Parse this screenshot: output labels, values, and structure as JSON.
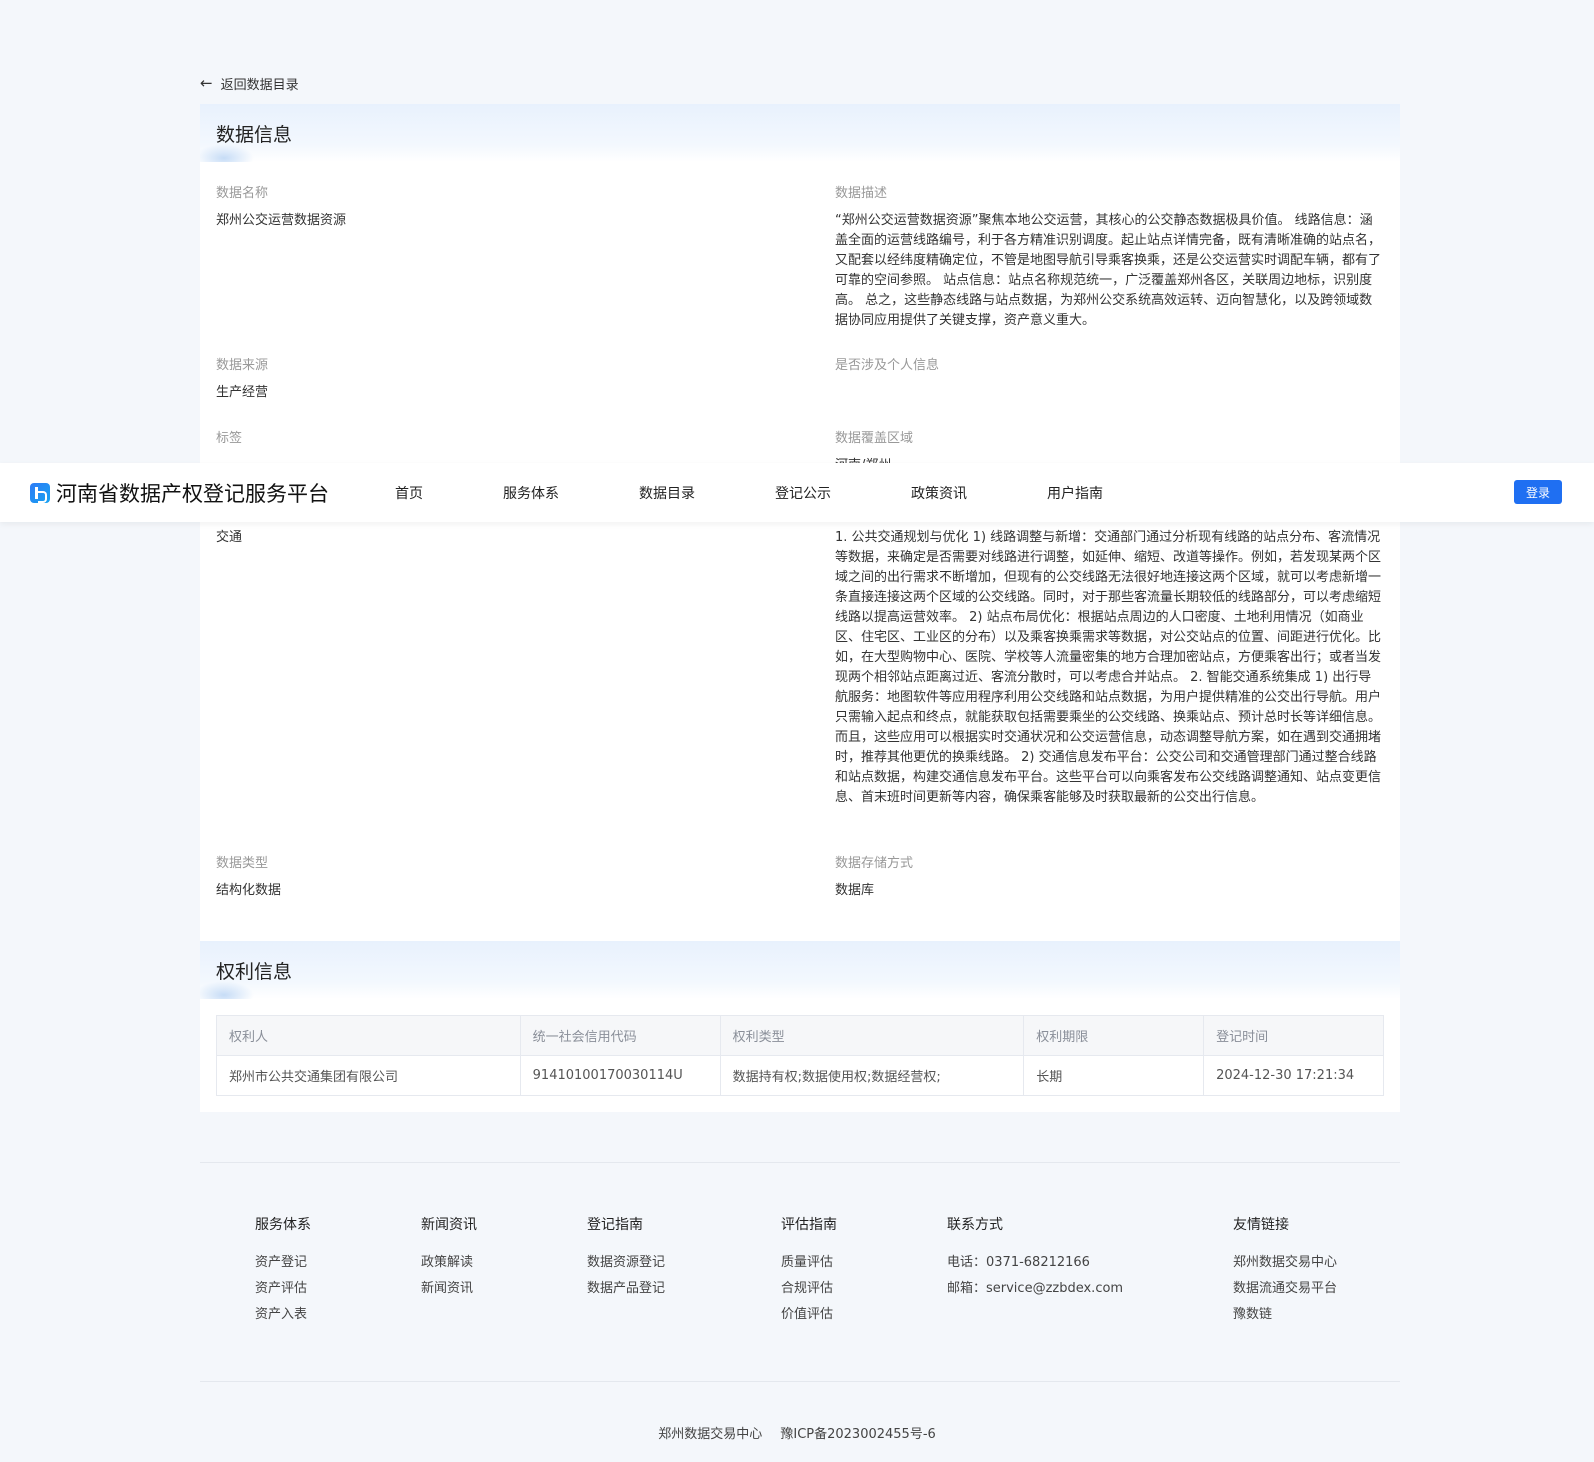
{
  "back_link": "返回数据目录",
  "data_info": {
    "section_title": "数据信息",
    "name_label": "数据名称",
    "name_value": "郑州公交运营数据资源",
    "desc_label": "数据描述",
    "desc_value": "“郑州公交运营数据资源”聚焦本地公交运营，其核心的公交静态数据极具价值。 线路信息：涵盖全面的运营线路编号，利于各方精准识别调度。起止站点详情完备，既有清晰准确的站点名，又配套以经纬度精确定位，不管是地图导航引导乘客换乘，还是公交运营实时调配车辆，都有了可靠的空间参照。 站点信息：站点名称规范统一，广泛覆盖郑州各区，关联周边地标，识别度高。 总之，这些静态线路与站点数据，为郑州公交系统高效运转、迈向智慧化，以及跨领域数据协同应用提供了关键支撑，资产意义重大。",
    "source_label": "数据来源",
    "source_value": "生产经营",
    "personal_label": "是否涉及个人信息",
    "personal_value": "",
    "tag_label": "标签",
    "coverage_label": "数据覆盖区域",
    "coverage_value": "河南/郑州",
    "industry_value": "交通",
    "scenario_value": "1. 公共交通规划与优化 1) 线路调整与新增：交通部门通过分析现有线路的站点分布、客流情况等数据，来确定是否需要对线路进行调整，如延伸、缩短、改道等操作。例如，若发现某两个区域之间的出行需求不断增加，但现有的公交线路无法很好地连接这两个区域，就可以考虑新增一条直接连接这两个区域的公交线路。同时，对于那些客流量长期较低的线路部分，可以考虑缩短线路以提高运营效率。 2) 站点布局优化：根据站点周边的人口密度、土地利用情况（如商业区、住宅区、工业区的分布）以及乘客换乘需求等数据，对公交站点的位置、间距进行优化。比如，在大型购物中心、医院、学校等人流量密集的地方合理加密站点，方便乘客出行；或者当发现两个相邻站点距离过近、客流分散时，可以考虑合并站点。 2. 智能交通系统集成 1) 出行导航服务：地图软件等应用程序利用公交线路和站点数据，为用户提供精准的公交出行导航。用户只需输入起点和终点，就能获取包括需要乘坐的公交线路、换乘站点、预计总时长等详细信息。而且，这些应用可以根据实时交通状况和公交运营信息，动态调整导航方案，如在遇到交通拥堵时，推荐其他更优的换乘线路。 2) 交通信息发布平台：公交公司和交通管理部门通过整合线路和站点数据，构建交通信息发布平台。这些平台可以向乘客发布公交线路调整通知、站点变更信息、首末班时间更新等内容，确保乘客能够及时获取最新的公交出行信息。",
    "type_label": "数据类型",
    "type_value": "结构化数据",
    "storage_label": "数据存储方式",
    "storage_value": "数据库"
  },
  "nav": {
    "brand": "河南省数据产权登记服务平台",
    "items": [
      "首页",
      "服务体系",
      "数据目录",
      "登记公示",
      "政策资讯",
      "用户指南"
    ],
    "login": "登录"
  },
  "rights": {
    "section_title": "权利信息",
    "headers": [
      "权利人",
      "统一社会信用代码",
      "权利类型",
      "权利期限",
      "登记时间"
    ],
    "rows": [
      [
        "郑州市公共交通集团有限公司",
        "91410100170030114U",
        "数据持有权;数据使用权;数据经营权;",
        "长期",
        "2024-12-30 17:21:34"
      ]
    ]
  },
  "footer": {
    "columns": [
      {
        "title": "服务体系",
        "links": [
          "资产登记",
          "资产评估",
          "资产入表"
        ]
      },
      {
        "title": "新闻资讯",
        "links": [
          "政策解读",
          "新闻资讯"
        ]
      },
      {
        "title": "登记指南",
        "links": [
          "数据资源登记",
          "数据产品登记"
        ]
      },
      {
        "title": "评估指南",
        "links": [
          "质量评估",
          "合规评估",
          "价值评估"
        ]
      },
      {
        "title": "联系方式",
        "links": [
          "电话：0371-68212166",
          "邮箱：service@zzbdex.com"
        ]
      },
      {
        "title": "友情链接",
        "links": [
          "郑州数据交易中心",
          "数据流通交易平台",
          "豫数链"
        ]
      }
    ],
    "copyright_org": "郑州数据交易中心",
    "copyright_icp": "豫ICP备2023002455号-6"
  },
  "colors": {
    "accent": "#1f6ff2",
    "page_bg": "#f4f7fb",
    "label_gray": "#999999"
  }
}
